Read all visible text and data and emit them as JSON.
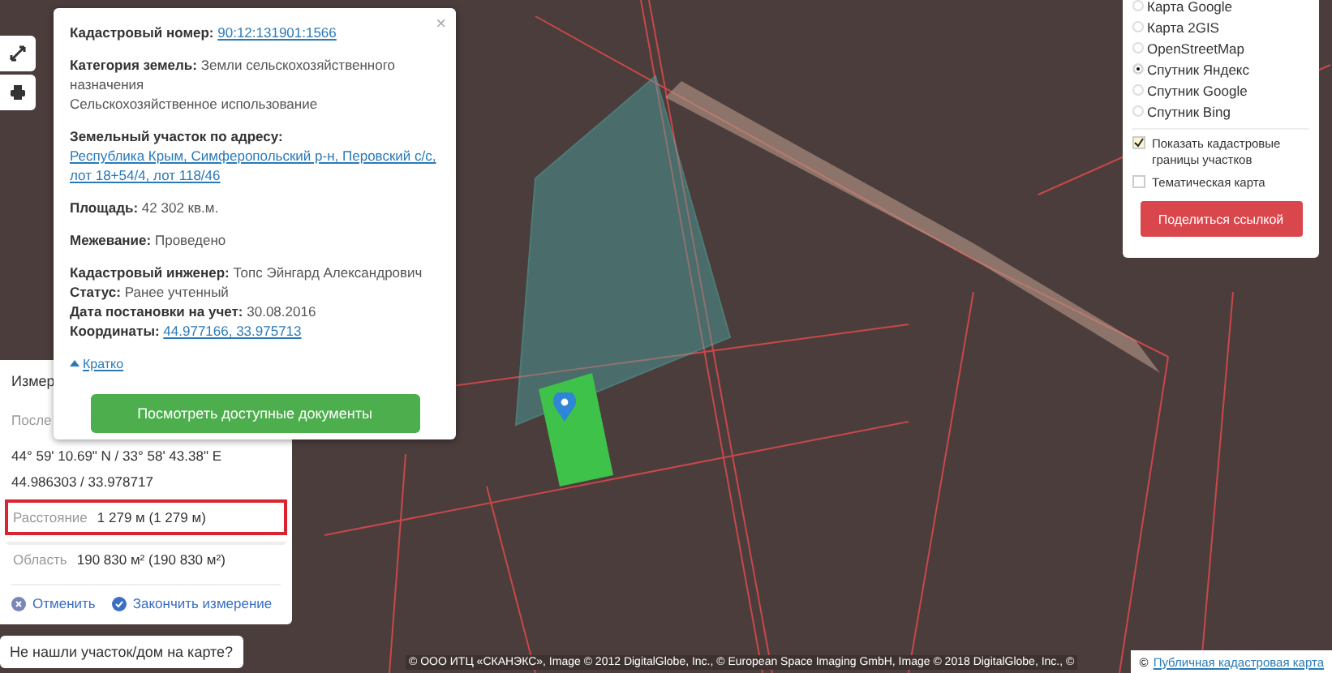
{
  "popup": {
    "close": "×",
    "groups": [
      [
        {
          "label": "Кадастровый номер:",
          "value": "90:12:131901:1566",
          "kind": "link"
        }
      ],
      [
        {
          "label": "Категория земель:",
          "value": "Земли сельскохозяйственного назначения",
          "note": "Сельскохозяйственное использование",
          "kind": "text"
        }
      ],
      [
        {
          "label": "Земельный участок по адресу:",
          "value": "Республика Крым, Симферопольский р-н, Перовский с/с, лот 18+54/4, лот 118/46",
          "kind": "block_link"
        }
      ],
      [
        {
          "label": "Площадь:",
          "value": "42 302 кв.м.",
          "kind": "text"
        }
      ],
      [
        {
          "label": "Межевание:",
          "value": "Проведено",
          "kind": "text"
        }
      ],
      [
        {
          "label": "Кадастровый инженер:",
          "value": "Топс Эйнгард Александрович",
          "kind": "text"
        },
        {
          "label": "Статус:",
          "value": "Ранее учтенный",
          "kind": "text"
        },
        {
          "label": "Дата постановки на учет:",
          "value": "30.08.2016",
          "kind": "text"
        },
        {
          "label": "Координаты:",
          "value": "44.977166, 33.975713",
          "kind": "link"
        }
      ]
    ],
    "collapse": "Кратко",
    "button": "Посмотреть доступные документы"
  },
  "measure": {
    "title": "Измер",
    "subtitle": "После",
    "dms": "44° 59' 10.69\" N / 33° 58' 43.38\" E",
    "decimal": "44.986303 / 33.978717",
    "rows": [
      {
        "label": "Расстояние",
        "value": "1 279 м (1 279 м)",
        "highlighted": true
      },
      {
        "label": "Область",
        "value": "190 830 м² (190 830 м²)",
        "highlighted": false
      }
    ],
    "actions": [
      {
        "label": "Отменить",
        "kind": "cancel"
      },
      {
        "label": "Закончить измерение",
        "kind": "finish"
      }
    ]
  },
  "layers": {
    "items": [
      {
        "label": "Карта Google",
        "selected": false
      },
      {
        "label": "Карта 2GIS",
        "selected": false
      },
      {
        "label": "OpenStreetMap",
        "selected": false
      },
      {
        "label": "Спутник Яндекс",
        "selected": true
      },
      {
        "label": "Спутник Google",
        "selected": false
      },
      {
        "label": "Спутник Bing",
        "selected": false
      }
    ],
    "checkboxes": [
      {
        "label": "Показать кадастровые границы участков",
        "checked": true
      },
      {
        "label": "Тематическая карта",
        "checked": false
      }
    ],
    "share": "Поделиться ссылкой"
  },
  "help_button": "Не нашли участок/дом на карте?",
  "attribution": "© ООО ИТЦ «СКАНЭКС», Image © 2012 DigitalGlobe, Inc., © European Space Imaging GmbH, Image © 2018 DigitalGlobe, Inc., ©",
  "source": {
    "mark": "©",
    "link": "Публичная кадастровая карта"
  }
}
